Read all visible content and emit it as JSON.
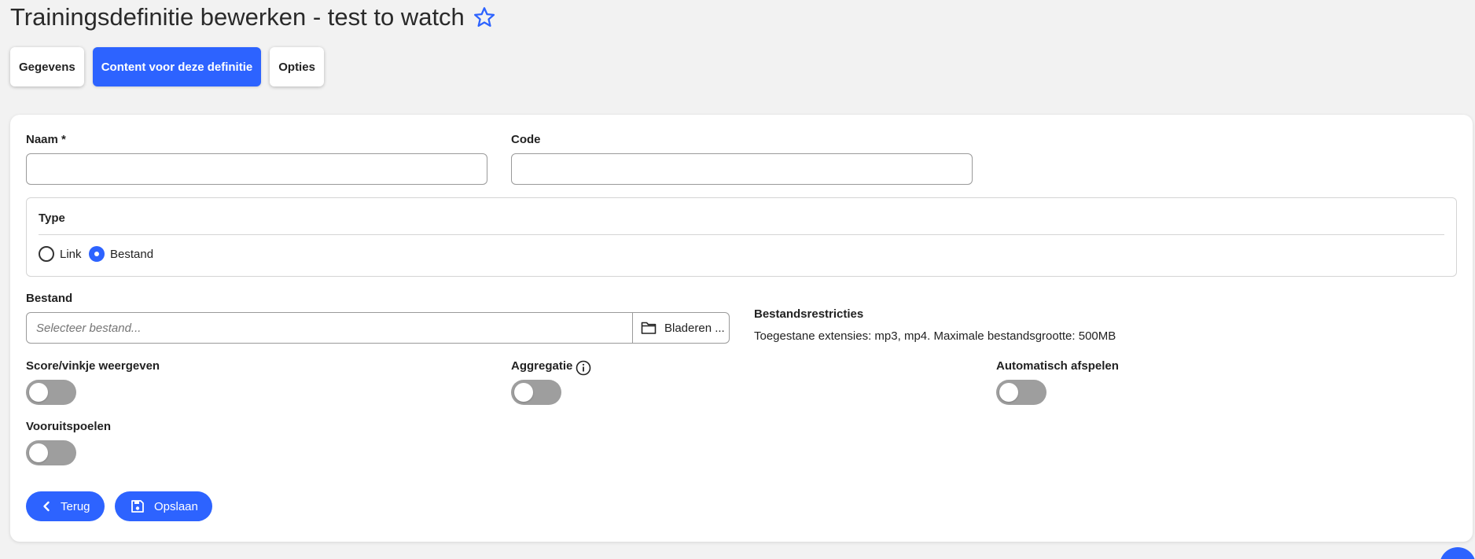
{
  "page": {
    "title": "Trainingsdefinitie bewerken - test to watch",
    "favorite_icon": "star-outline-icon"
  },
  "tabs": [
    {
      "label": "Gegevens",
      "active": false
    },
    {
      "label": "Content voor deze definitie",
      "active": true
    },
    {
      "label": "Opties",
      "active": false
    }
  ],
  "form": {
    "name_label": "Naam *",
    "name_value": "",
    "code_label": "Code",
    "code_value": "",
    "type_label": "Type",
    "type_options": [
      {
        "label": "Link",
        "checked": false
      },
      {
        "label": "Bestand",
        "checked": true
      }
    ],
    "file_label": "Bestand",
    "file_placeholder": "Selecteer bestand...",
    "browse_label": "Bladeren ...",
    "browse_icon": "folder-icon",
    "restrictions_title": "Bestandsrestricties",
    "restrictions_text": "Toegestane extensies: mp3, mp4. Maximale bestandsgrootte: 500MB",
    "toggles": [
      {
        "label": "Score/vinkje weergeven",
        "on": false
      },
      {
        "label": "Aggregatie",
        "on": false,
        "icon": "info-icon"
      },
      {
        "label": "Automatisch afspelen",
        "on": false
      },
      {
        "label": "Vooruitspoelen",
        "on": false
      }
    ]
  },
  "actions": {
    "back_label": "Terug",
    "back_icon": "chevron-left-icon",
    "save_label": "Opslaan",
    "save_icon": "save-icon"
  },
  "colors": {
    "accent": "#2d63ff",
    "toggle_off": "#9e9e9e",
    "background": "#f2f2f2"
  }
}
